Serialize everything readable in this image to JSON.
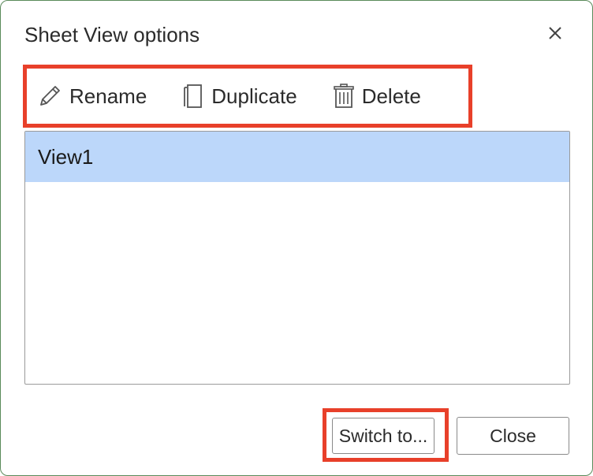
{
  "dialog": {
    "title": "Sheet View options"
  },
  "toolbar": {
    "rename_label": "Rename",
    "duplicate_label": "Duplicate",
    "delete_label": "Delete"
  },
  "views": {
    "items": [
      {
        "label": "View1",
        "selected": true
      }
    ]
  },
  "footer": {
    "switch_label": "Switch to...",
    "close_label": "Close"
  },
  "colors": {
    "highlight": "#e8402a",
    "selection": "#bcd7fa"
  }
}
